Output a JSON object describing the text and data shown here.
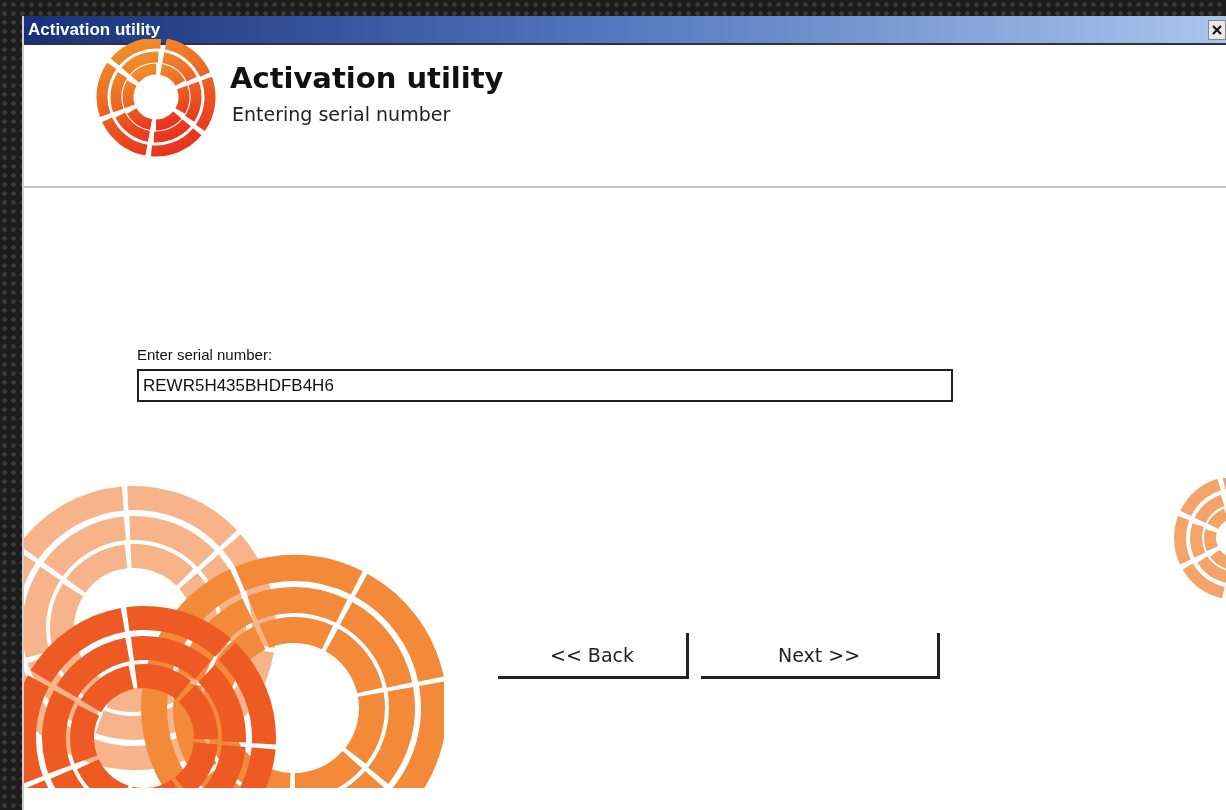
{
  "window": {
    "title": "Activation utility"
  },
  "header": {
    "title": "Activation utility",
    "subtitle": "Entering serial number"
  },
  "serial": {
    "label": "Enter serial number:",
    "value": "REWR5H435BHDFB4H6"
  },
  "buttons": [
    {
      "label": "<< Back"
    },
    {
      "label": "Next >>"
    }
  ]
}
